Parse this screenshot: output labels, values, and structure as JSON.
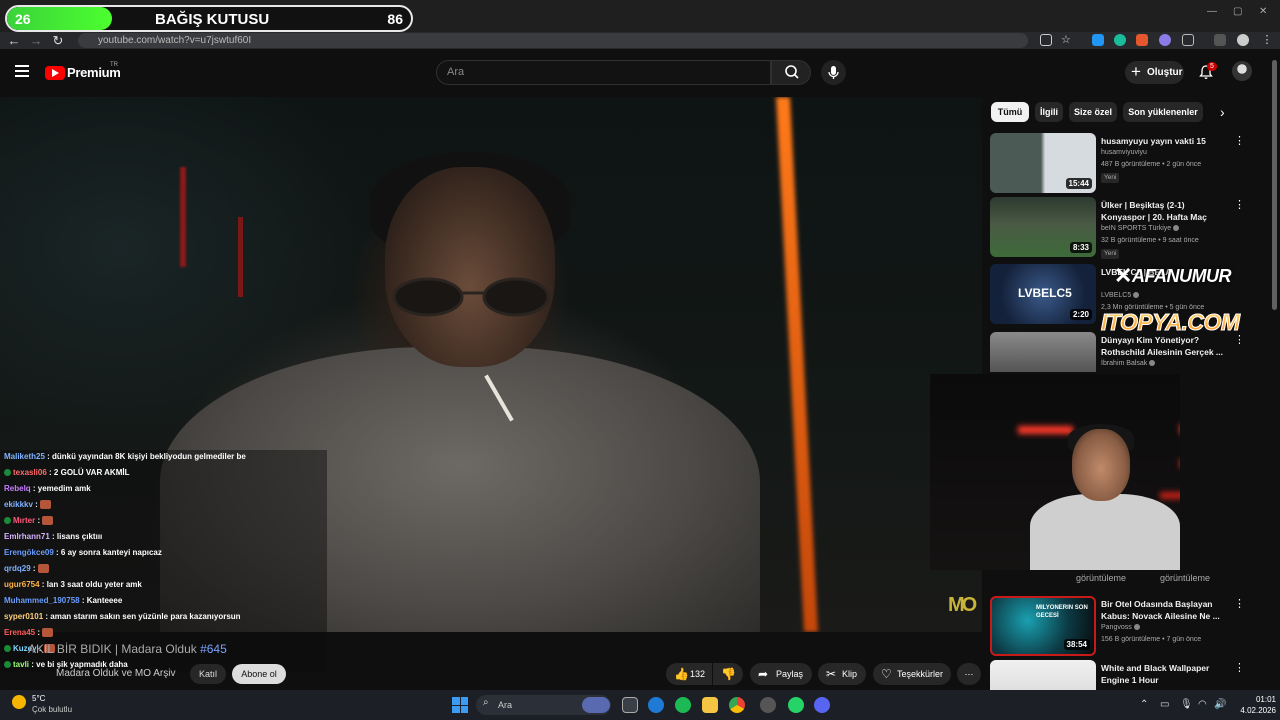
{
  "donation": {
    "min": "26",
    "title": "BAĞIŞ KUTUSU",
    "max": "86",
    "progress": 0.26
  },
  "browser": {
    "url": "youtube.com/watch?v=u7jswtuf60I"
  },
  "header": {
    "brand": "Premium",
    "region": "TR",
    "search_placeholder": "Ara",
    "create_label": "Oluştur",
    "notifications_count": "5"
  },
  "video": {
    "title_prefix": "AKIL BİR BIDIK | Madara Olduk ",
    "title_episode": "#645",
    "channel": "Madara Olduk ve MO Arşiv",
    "join_label": "Katıl",
    "subscribe_label": "Abone ol",
    "likes": "132",
    "share_label": "Paylaş",
    "clip_label": "Klip",
    "thanks_label": "Teşekkürler"
  },
  "chat": [
    {
      "user": "Maliketh25",
      "color": "#7fb2ff",
      "msg": "dünkü yayından 8K kişiyi bekliyodun gelmediler be",
      "badge": false,
      "emote": false
    },
    {
      "user": "texasli06",
      "color": "#ff6a6a",
      "msg": "2 GOLÜ VAR AKMİL",
      "badge": true,
      "emote": false
    },
    {
      "user": "Rebelq",
      "color": "#c77dff",
      "msg": "yemedim amk",
      "badge": false,
      "emote": false
    },
    {
      "user": "ekikkkv",
      "color": "#7fb2ff",
      "msg": "",
      "badge": false,
      "emote": true
    },
    {
      "user": "Mırter",
      "color": "#ff5a7a",
      "msg": "",
      "badge": true,
      "emote": true
    },
    {
      "user": "Emlrhann71",
      "color": "#d6b3ff",
      "msg": "lisans çıktııı",
      "badge": false,
      "emote": false
    },
    {
      "user": "Erengökce09",
      "color": "#6a9cff",
      "msg": "6 ay sonra kanteyi napıcaz",
      "badge": false,
      "emote": false
    },
    {
      "user": "qrdq29",
      "color": "#7fb2ff",
      "msg": "",
      "badge": false,
      "emote": true
    },
    {
      "user": "ugur6754",
      "color": "#ffb347",
      "msg": "lan 3 saat oldu yeter amk",
      "badge": false,
      "emote": false
    },
    {
      "user": "Muhammed_190758",
      "color": "#6a9cff",
      "msg": "Kanteeee",
      "badge": false,
      "emote": false
    },
    {
      "user": "syper0101",
      "color": "#ffd07a",
      "msg": "aman starım sakın sen yüzünle para kazanıyorsun",
      "badge": false,
      "emote": false
    },
    {
      "user": "Erena45",
      "color": "#ff5a5a",
      "msg": "",
      "badge": false,
      "emote": true
    },
    {
      "user": "Kuzey",
      "color": "#7fd6ff",
      "msg": "",
      "badge": true,
      "emote": true
    },
    {
      "user": "tavli",
      "color": "#9cff7a",
      "msg": "ve bi şik yapmadık daha",
      "badge": true,
      "emote": false
    }
  ],
  "chips": [
    "Tümü",
    "İlgili",
    "Size özel",
    "Son yüklenenler"
  ],
  "recommendations": [
    {
      "title": "husamyuyu yayın vakti 15",
      "channel": "husamviyuviyu",
      "meta": "487 B görüntüleme • 2 gün önce",
      "badge": "Yeni",
      "duration": "15:44",
      "verified": false
    },
    {
      "title": "Ülker | Beşiktaş (2-1) Konyaspor | 20. Hafta Maç ÖZETİ | Trendy...",
      "channel": "beIN SPORTS Türkiye",
      "meta": "32 B görüntüleme • 9 saat önce",
      "badge": "Yeni",
      "duration": "8:33",
      "verified": true
    },
    {
      "title": "LVBEL C5 | BELA",
      "channel": "LVBELC5",
      "meta": "2,3 Mn görüntüleme • 5 gün önce",
      "badge": "",
      "duration": "2:20",
      "verified": true
    },
    {
      "title": "Dünyayı Kim Yönetiyor? Rothschild Ailesinin Gerçek ...",
      "channel": "İbrahim Balsak",
      "meta": "",
      "badge": "",
      "duration": "",
      "verified": true
    },
    {
      "title": "Bir Otel Odasında Başlayan Kabus: Novack Ailesine Ne ...",
      "channel": "Pangvoss",
      "meta": "156 B görüntüleme • 7 gün önce",
      "badge": "",
      "duration": "38:54",
      "verified": true
    },
    {
      "title": "White and Black Wallpaper Engine 1 Hour",
      "channel": "",
      "meta": "",
      "badge": "",
      "duration": "",
      "verified": false
    }
  ],
  "views_labels": [
    "görüntüleme",
    "görüntüleme"
  ],
  "overlay": {
    "afan": "AFANUMUR",
    "itopya": "ITOPYA.COM",
    "mo_logo": "MO",
    "thumb_lvbel": "LVBELC5",
    "thumb_milyoner": "MILYONERIN SON GECESİ"
  },
  "taskbar": {
    "temp": "5°C",
    "weather": "Çok bulutlu",
    "search": "Ara",
    "time": "01:01",
    "date": "4.02.2026"
  }
}
